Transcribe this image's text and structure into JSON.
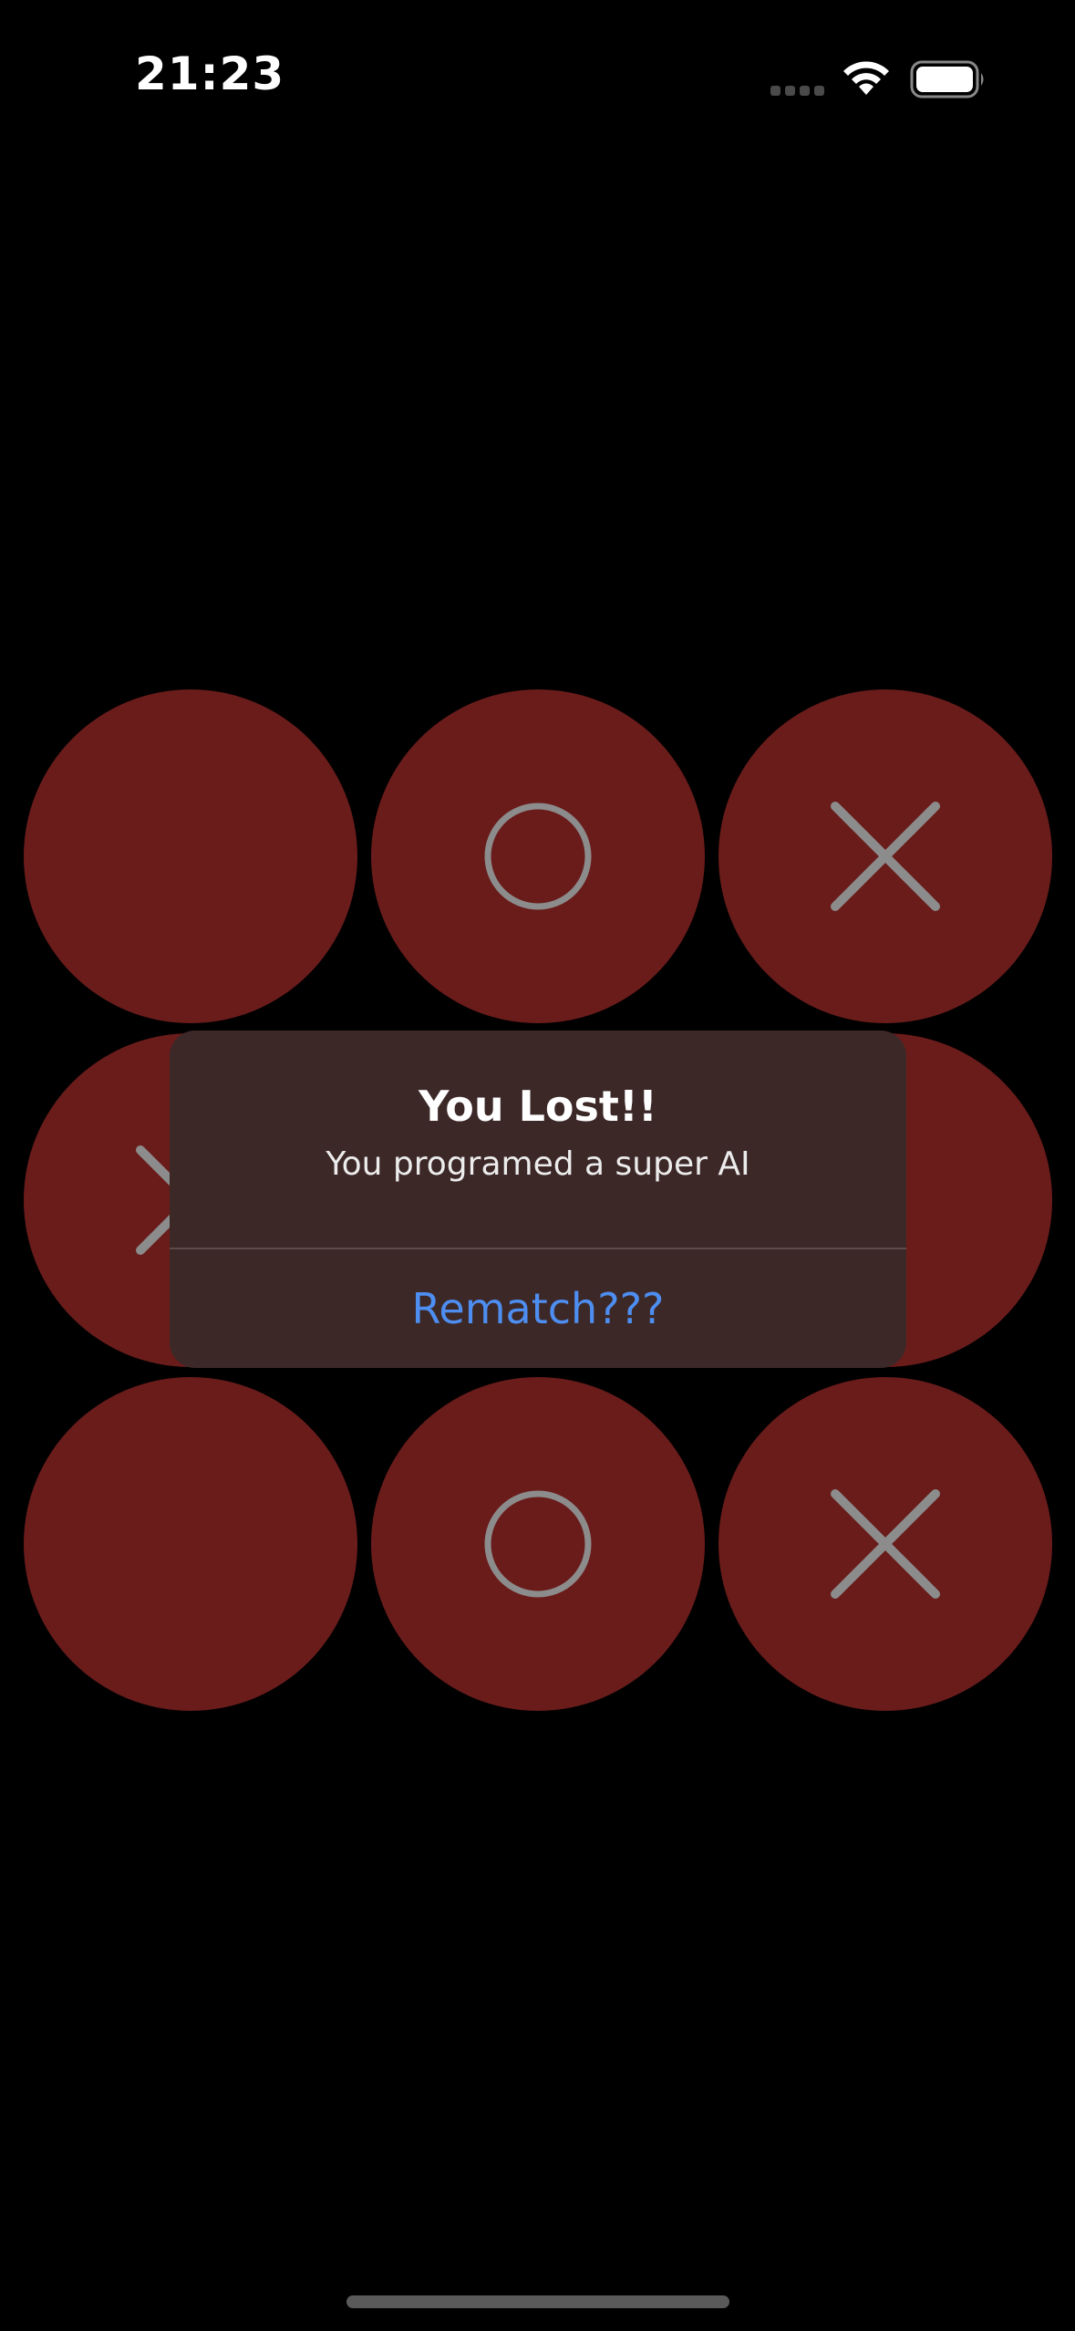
{
  "status_bar": {
    "time": "21:23",
    "signal_icon": "cellular-signal-icon",
    "wifi_icon": "wifi-icon",
    "battery_icon": "battery-icon"
  },
  "board": {
    "cells": [
      {
        "mark": ""
      },
      {
        "mark": "O"
      },
      {
        "mark": "X"
      },
      {
        "mark": "X"
      },
      {
        "mark": ""
      },
      {
        "mark": ""
      },
      {
        "mark": ""
      },
      {
        "mark": "O"
      },
      {
        "mark": "X"
      }
    ],
    "colors": {
      "cell": "#6a1c1b",
      "mark": "#8c8c8c",
      "background": "#000000"
    }
  },
  "alert": {
    "title": "You Lost!!",
    "message": "You programed a super AI",
    "button_label": "Rematch???",
    "button_color": "#4d8ef0"
  }
}
